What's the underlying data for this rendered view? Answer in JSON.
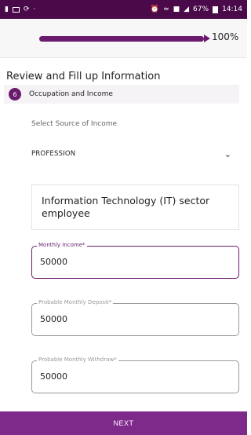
{
  "status_bar": {
    "left_icons": [
      "message-icon",
      "gallery-icon",
      "sync-icon"
    ],
    "right_icons": [
      "alarm-icon",
      "wifi-icon",
      "data-icon",
      "signal-icon",
      "battery-icon"
    ],
    "battery": "67%",
    "time": "14:14",
    "background_color": "#4a0a4a"
  },
  "progress": {
    "value": 1.0,
    "label": "100%",
    "color": "#6a1b6e"
  },
  "page": {
    "title": "Review and Fill up Information"
  },
  "step": {
    "number": "6",
    "label": "Occupation and Income"
  },
  "income_source": {
    "label": "Select Source of Income",
    "selected": "PROFESSION",
    "description": "Information Technology (IT) sector employee"
  },
  "fields": {
    "monthly_income": {
      "label": "Monthly Income*",
      "value": "50000"
    },
    "monthly_deposit": {
      "label": "Probable Monthly Deposit*",
      "value": "50000"
    },
    "monthly_withdraw": {
      "label": "Probable Monthly Withdraw*",
      "value": "50000"
    }
  },
  "footer": {
    "next_label": "NEXT",
    "accent_color": "#7e2a8a"
  }
}
